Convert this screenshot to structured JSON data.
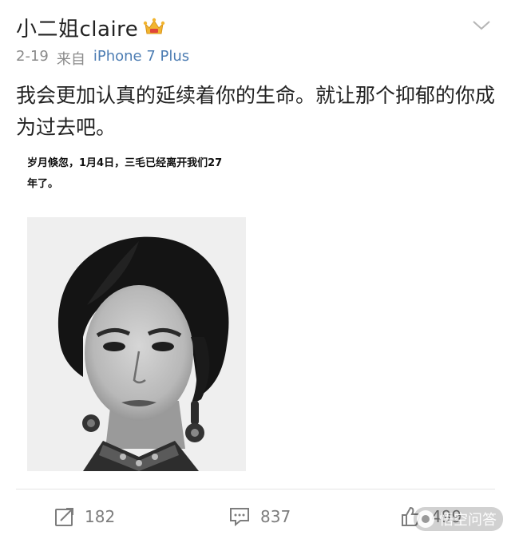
{
  "header": {
    "user_name": "小二姐claire",
    "date": "2-19",
    "source_prefix": "来自",
    "source_device": "iPhone 7 Plus"
  },
  "post": {
    "text": "我会更加认真的延续着你的生命。就让那个抑郁的你成为过去吧。"
  },
  "embedded": {
    "line1": "岁月倏忽，1月4日，三毛已经离开我们27",
    "line2": "年了。"
  },
  "actions": {
    "repost_count": "182",
    "comment_count": "837",
    "like_count": "499"
  },
  "watermark": {
    "text": "悟空问答"
  },
  "icons": {
    "crown": "crown-icon",
    "chevron": "chevron-down-icon",
    "repost": "repost-icon",
    "comment": "comment-icon",
    "like": "thumbs-up-icon"
  },
  "colors": {
    "source_link": "#4d7db3",
    "meta_text": "#8a8a8a",
    "action_text": "#7d7d7d",
    "crown_gold": "#f2b530",
    "crown_red": "#e0453a"
  }
}
